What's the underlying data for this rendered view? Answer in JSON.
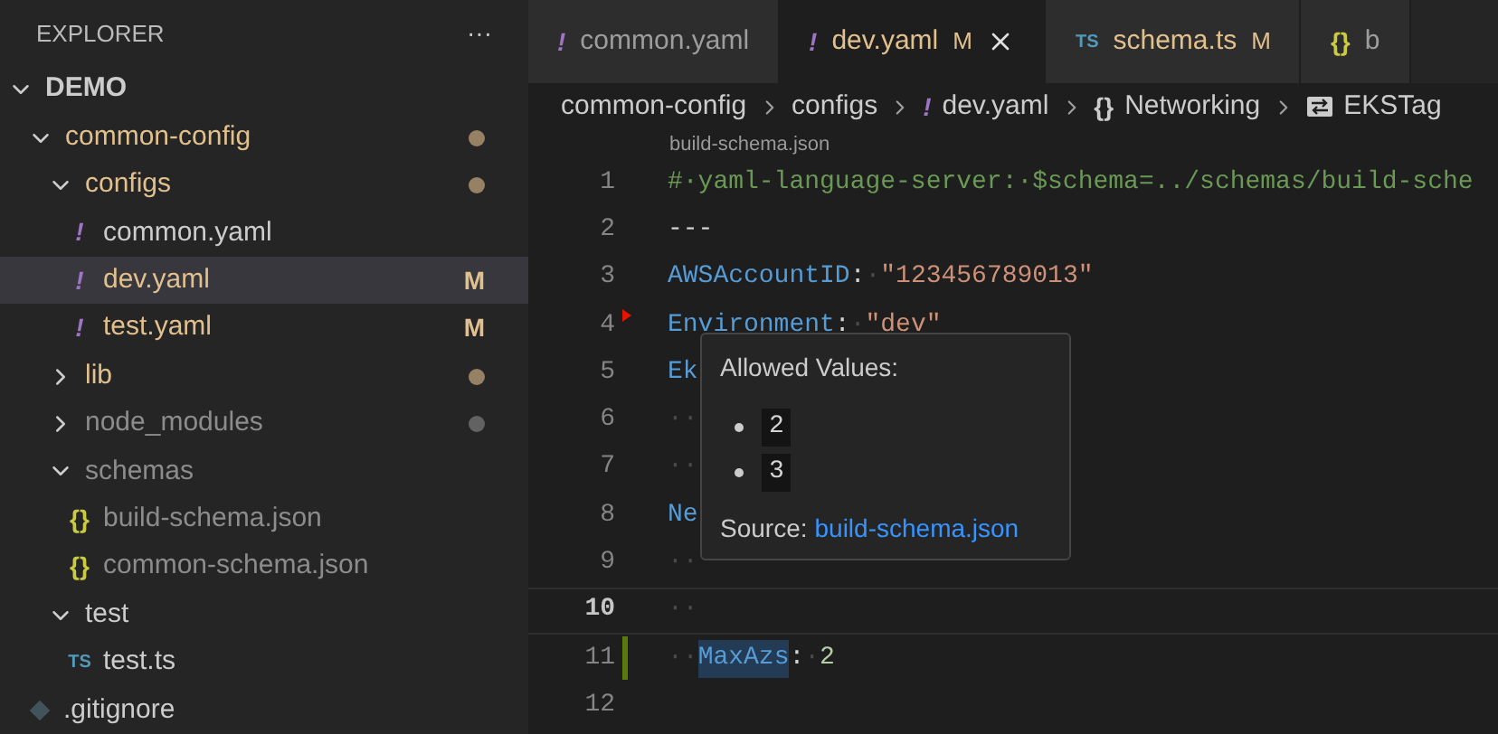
{
  "sidebar": {
    "title": "EXPLORER",
    "more": "···",
    "tree": [
      {
        "name": "DEMO",
        "kind": "root",
        "expanded": true,
        "color": "#cccccc",
        "children": [
          {
            "name": "common-config",
            "kind": "folder",
            "expanded": true,
            "color": "#e2c08d",
            "dot": true,
            "children": [
              {
                "name": "configs",
                "kind": "folder",
                "expanded": true,
                "color": "#e2c08d",
                "dot": true,
                "children": [
                  {
                    "name": "common.yaml",
                    "kind": "yaml",
                    "icon": "!",
                    "color": "#cccccc",
                    "selected": false
                  },
                  {
                    "name": "dev.yaml",
                    "kind": "yaml",
                    "icon": "!",
                    "color": "#e2c08d",
                    "badge": "M",
                    "selected": true
                  },
                  {
                    "name": "test.yaml",
                    "kind": "yaml",
                    "icon": "!",
                    "color": "#e2c08d",
                    "badge": "M",
                    "selected": false
                  }
                ]
              },
              {
                "name": "lib",
                "kind": "folder",
                "expanded": false,
                "color": "#e2c08d",
                "dot": true
              },
              {
                "name": "node_modules",
                "kind": "folder",
                "expanded": false,
                "color": "#8c8c8c",
                "dot": true
              },
              {
                "name": "schemas",
                "kind": "folder",
                "expanded": true,
                "color": "#8c8c8c",
                "children": [
                  {
                    "name": "build-schema.json",
                    "kind": "json",
                    "icon": "{}",
                    "color": "#8c8c8c",
                    "selected": false
                  },
                  {
                    "name": "common-schema.json",
                    "kind": "json",
                    "icon": "{}",
                    "color": "#8c8c8c",
                    "selected": false
                  }
                ]
              },
              {
                "name": "test",
                "kind": "folder",
                "expanded": true,
                "color": "#cccccc",
                "children": [
                  {
                    "name": "test.ts",
                    "kind": "ts",
                    "icon": "TS",
                    "color": "#cccccc",
                    "selected": false
                  }
                ]
              }
            ]
          },
          {
            "name": ".gitignore",
            "kind": "git",
            "color": "#cccccc",
            "selected": false
          }
        ]
      }
    ]
  },
  "tabs": [
    {
      "label": "common.yaml",
      "icon": "!",
      "kind": "yaml",
      "selected": false,
      "color": "#9d9d9d"
    },
    {
      "label": "dev.yaml",
      "icon": "!",
      "kind": "yaml",
      "selected": true,
      "color": "#e2c08d",
      "badge": "M"
    },
    {
      "label": "schema.ts",
      "icon": "TS",
      "kind": "ts",
      "selected": false,
      "color": "#e2c08d",
      "badge": "M"
    },
    {
      "label": "b",
      "icon": "{}",
      "kind": "json",
      "selected": false,
      "color": "#9d9d9d"
    }
  ],
  "breadcrumb": [
    {
      "label": "common-config",
      "kind": "text"
    },
    {
      "label": "configs",
      "kind": "text"
    },
    {
      "label": "dev.yaml",
      "kind": "yaml",
      "icon": "!"
    },
    {
      "label": "Networking",
      "kind": "object",
      "icon": "{}"
    },
    {
      "label": "EKSTag",
      "kind": "symbol"
    }
  ],
  "codelens": "build-schema.json",
  "lines": [
    {
      "number": "1",
      "tokens": [
        {
          "text": "#·yaml-language-server:·$schema=../schemas/build-sche",
          "kind": "comment"
        }
      ]
    },
    {
      "number": "2",
      "tokens": [
        {
          "text": "---",
          "kind": "punct"
        }
      ]
    },
    {
      "number": "3",
      "tokens": [
        {
          "text": "AWSAccountID",
          "kind": "key"
        },
        {
          "text": ":",
          "kind": "punct"
        },
        {
          "text": "·",
          "kind": "space"
        },
        {
          "text": "\"123456789013\"",
          "kind": "string"
        }
      ]
    },
    {
      "number": "4",
      "error": true,
      "tokens": [
        {
          "text": "Environment",
          "kind": "key"
        },
        {
          "text": ":",
          "kind": "punct"
        },
        {
          "text": "·",
          "kind": "space"
        },
        {
          "text": "\"dev\"",
          "kind": "string"
        }
      ]
    },
    {
      "number": "5",
      "tokens": [
        {
          "text": "Ek",
          "kind": "key"
        }
      ]
    },
    {
      "number": "6",
      "tokens": [
        {
          "text": "··",
          "kind": "space"
        }
      ]
    },
    {
      "number": "7",
      "tokens": [
        {
          "text": "··",
          "kind": "space"
        }
      ]
    },
    {
      "number": "8",
      "tokens": [
        {
          "text": "Ne",
          "kind": "key"
        }
      ]
    },
    {
      "number": "9",
      "tokens": [
        {
          "text": "··",
          "kind": "space"
        }
      ]
    },
    {
      "number": "10",
      "current": true,
      "tokens": [
        {
          "text": "··",
          "kind": "space"
        }
      ]
    },
    {
      "number": "11",
      "added": true,
      "tokens": [
        {
          "text": "··",
          "kind": "space"
        },
        {
          "text": "MaxAzs",
          "kind": "key",
          "highlight": true
        },
        {
          "text": ":",
          "kind": "punct"
        },
        {
          "text": "·",
          "kind": "space"
        },
        {
          "text": "2",
          "kind": "number"
        }
      ]
    },
    {
      "number": "12"
    }
  ],
  "hover": {
    "title": "Allowed Values:",
    "values": [
      "2",
      "3"
    ],
    "source_label": "Source:",
    "source_link": "build-schema.json"
  }
}
